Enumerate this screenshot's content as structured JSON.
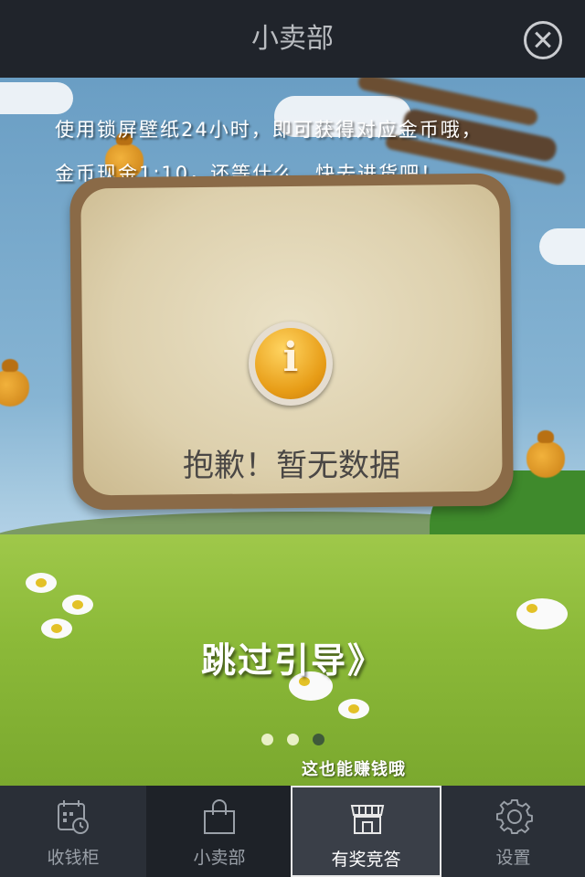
{
  "header": {
    "title": "小卖部"
  },
  "guide": {
    "line1": "使用锁屏壁纸24小时，即可获得对应金币哦，",
    "line2": "金币现金1:10，还等什么，快去进货吧！"
  },
  "empty_state": {
    "message": "抱歉！暂无数据",
    "icon": "info-icon"
  },
  "skip_label": "跳过引导》",
  "pager": {
    "count": 3,
    "active": 2
  },
  "hint": "这也能赚钱哦",
  "tabs": [
    {
      "label": "收钱柜",
      "icon": "cash-register-icon"
    },
    {
      "label": "小卖部",
      "icon": "shopping-bag-icon"
    },
    {
      "label": "有奖竞答",
      "icon": "shop-awning-icon",
      "selected": true
    },
    {
      "label": "设置",
      "icon": "gear-icon"
    }
  ],
  "colors": {
    "topbar": "#20242b",
    "tabbar": "#2a2f37",
    "selected_tab": "#3a3f48"
  }
}
